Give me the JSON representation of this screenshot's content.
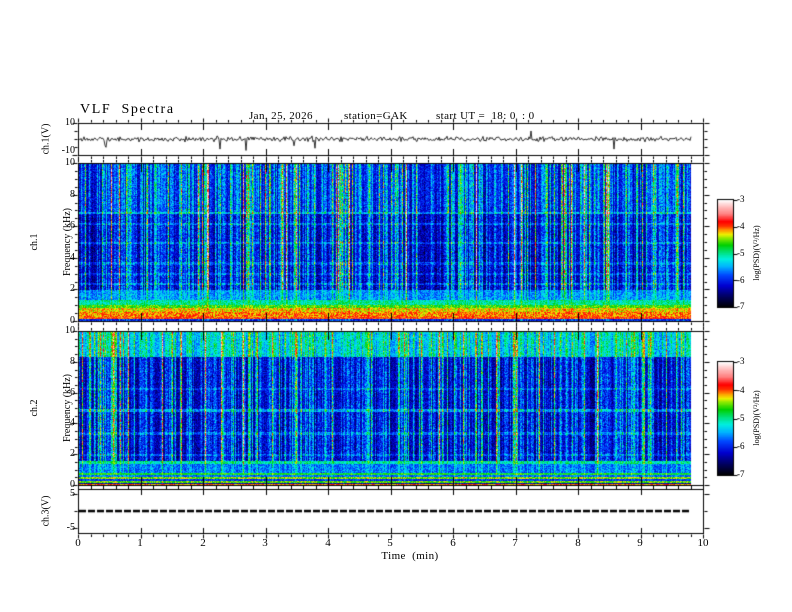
{
  "header": {
    "title": "VLF  Spectra",
    "date": "Jan. 25, 2026",
    "station": "station=GAK",
    "start_ut": "start UT =  18: 0  : 0"
  },
  "panels": {
    "ch1": {
      "ylabel": "ch.1(V)",
      "yticks": [
        "10",
        "-10"
      ]
    },
    "spec1": {
      "ylabel_ch": "ch.1",
      "ylabel_freq": "Frequency (kHz)",
      "yticks": [
        "10",
        "8",
        "6",
        "4",
        "2",
        "0"
      ]
    },
    "spec2": {
      "ylabel_ch": "ch.2",
      "ylabel_freq": "Frequency (kHz)",
      "yticks": [
        "10",
        "8",
        "6",
        "4",
        "2",
        "0"
      ]
    },
    "ch3": {
      "ylabel": "ch.3(V)",
      "yticks": [
        "5",
        "-5"
      ]
    }
  },
  "xaxis": {
    "label": "Time  (min)",
    "ticks": [
      "0",
      "1",
      "2",
      "3",
      "4",
      "5",
      "6",
      "7",
      "8",
      "9",
      "10"
    ]
  },
  "colorbar1": {
    "label": "log(PSD)(V²/Hz)",
    "ticks": [
      "-3",
      "-4",
      "-5",
      "-6",
      "-7"
    ]
  },
  "colorbar2": {
    "label": "log(PSD)(V²/Hz)",
    "ticks": [
      "-3",
      "-4",
      "-5",
      "-6",
      "-7"
    ]
  },
  "chart_data": {
    "type": "multi-panel",
    "title": "VLF Spectra",
    "date": "Jan. 25, 2026",
    "station": "GAK",
    "start_ut": "18:0:0",
    "time_axis": {
      "label": "Time (min)",
      "range_min": [
        0,
        10
      ],
      "data_extent_min": [
        0,
        9.8
      ],
      "major_tick_min": 1,
      "minor_tick_min": 0.2
    },
    "colormap": {
      "label": "log(PSD)(V²/Hz)",
      "range": [
        -7,
        -3
      ],
      "ticks": [
        -3,
        -4,
        -5,
        -6,
        -7
      ],
      "stops": [
        [
          0,
          "#000000"
        ],
        [
          0.1,
          "#000060"
        ],
        [
          0.2,
          "#0000d0"
        ],
        [
          0.3,
          "#0048ff"
        ],
        [
          0.38,
          "#00b4ff"
        ],
        [
          0.45,
          "#00f0e0"
        ],
        [
          0.52,
          "#00e070"
        ],
        [
          0.58,
          "#00d000"
        ],
        [
          0.64,
          "#80e800"
        ],
        [
          0.68,
          "#f0f000"
        ],
        [
          0.72,
          "#ff9800"
        ],
        [
          0.76,
          "#ff3000"
        ],
        [
          0.8,
          "#ff0000"
        ],
        [
          0.87,
          "#ff8080"
        ],
        [
          0.94,
          "#ffc0c0"
        ],
        [
          1,
          "#ffffff"
        ]
      ]
    },
    "panels": [
      {
        "id": "ch1-waveform",
        "type": "line",
        "ylabel": "ch.1(V)",
        "ylim": [
          -10,
          10
        ],
        "yticks": [
          10,
          -10
        ],
        "signal": {
          "baseline_v": 0,
          "noise_amplitude_v": 1.5,
          "downward_spikes_to_v": -8,
          "upward_spikes_to_v": 6
        },
        "line_color": "#000000",
        "seed": 11
      },
      {
        "id": "ch1-spectrogram",
        "type": "heatmap",
        "ylabel": "ch.1 Frequency (kHz)",
        "ylim": [
          0,
          10
        ],
        "yticks": [
          0,
          2,
          4,
          6,
          8,
          10
        ],
        "z_range": [
          -7,
          -3
        ],
        "bands": [
          {
            "lo": 0.0,
            "hi": 0.15,
            "base": 0.22,
            "stripe": 0.2
          },
          {
            "lo": 0.15,
            "hi": 0.3,
            "base": 0.76,
            "stripe": 0.05
          },
          {
            "lo": 0.3,
            "hi": 0.6,
            "base": 0.72,
            "stripe": 0.06
          },
          {
            "lo": 0.6,
            "hi": 0.85,
            "base": 0.68,
            "stripe": 0.06
          },
          {
            "lo": 0.85,
            "hi": 1.05,
            "base": 0.58,
            "stripe": 0.1
          },
          {
            "lo": 1.05,
            "hi": 1.4,
            "base": 0.46,
            "stripe": 0.15
          },
          {
            "lo": 1.4,
            "hi": 2.0,
            "base": 0.3,
            "stripe": 0.35
          },
          {
            "lo": 2.0,
            "hi": 7.0,
            "base": 0.09,
            "stripe": 0.82
          },
          {
            "lo": 7.0,
            "hi": 10.1,
            "base": 0.14,
            "stripe": 0.85
          }
        ],
        "h_lines": [
          {
            "f": 6.9,
            "amp": 0.18
          },
          {
            "f": 6.2,
            "amp": 0.1
          },
          {
            "f": 5.0,
            "amp": 0.1
          },
          {
            "f": 3.7,
            "amp": 0.08
          },
          {
            "f": 3.0,
            "amp": 0.08
          },
          {
            "f": 2.4,
            "amp": 0.1
          }
        ],
        "seed": 22
      },
      {
        "id": "ch2-spectrogram",
        "type": "heatmap",
        "ylabel": "ch.2 Frequency (kHz)",
        "ylim": [
          0,
          10
        ],
        "yticks": [
          0,
          2,
          4,
          6,
          8,
          10
        ],
        "z_range": [
          -7,
          -3
        ],
        "bands": [
          {
            "lo": 0.0,
            "hi": 0.1,
            "base": 0.72,
            "stripe": 0.05
          },
          {
            "lo": 0.1,
            "hi": 0.18,
            "base": 0.15,
            "stripe": 0.1
          },
          {
            "lo": 0.18,
            "hi": 0.32,
            "base": 0.6,
            "stripe": 0.08
          },
          {
            "lo": 0.32,
            "hi": 0.4,
            "base": 0.25,
            "stripe": 0.1
          },
          {
            "lo": 0.4,
            "hi": 0.55,
            "base": 0.62,
            "stripe": 0.08
          },
          {
            "lo": 0.55,
            "hi": 0.68,
            "base": 0.3,
            "stripe": 0.15
          },
          {
            "lo": 0.68,
            "hi": 0.8,
            "base": 0.55,
            "stripe": 0.1
          },
          {
            "lo": 0.8,
            "hi": 1.6,
            "base": 0.28,
            "stripe": 0.3
          },
          {
            "lo": 1.6,
            "hi": 8.4,
            "base": 0.1,
            "stripe": 0.75
          },
          {
            "lo": 8.4,
            "hi": 10.1,
            "base": 0.32,
            "stripe": 0.65
          }
        ],
        "h_lines": [
          {
            "f": 6.3,
            "amp": 0.08
          },
          {
            "f": 4.9,
            "amp": 0.15
          },
          {
            "f": 3.4,
            "amp": 0.1
          },
          {
            "f": 2.0,
            "amp": 0.08
          },
          {
            "f": 1.5,
            "amp": 0.15
          }
        ],
        "seed": 33
      },
      {
        "id": "ch3-line",
        "type": "line",
        "ylabel": "ch.3(V)",
        "ylim": [
          -6.3,
          6.3
        ],
        "yticks": [
          5,
          -5
        ],
        "signal": {
          "constant_v": 0,
          "style": "dashed"
        },
        "line_color": "#000000",
        "seed": 44
      }
    ],
    "stripe_distribution": {
      "dark": 0.42,
      "mid": 0.34,
      "bright": 0.19,
      "hot": 0.05
    }
  }
}
